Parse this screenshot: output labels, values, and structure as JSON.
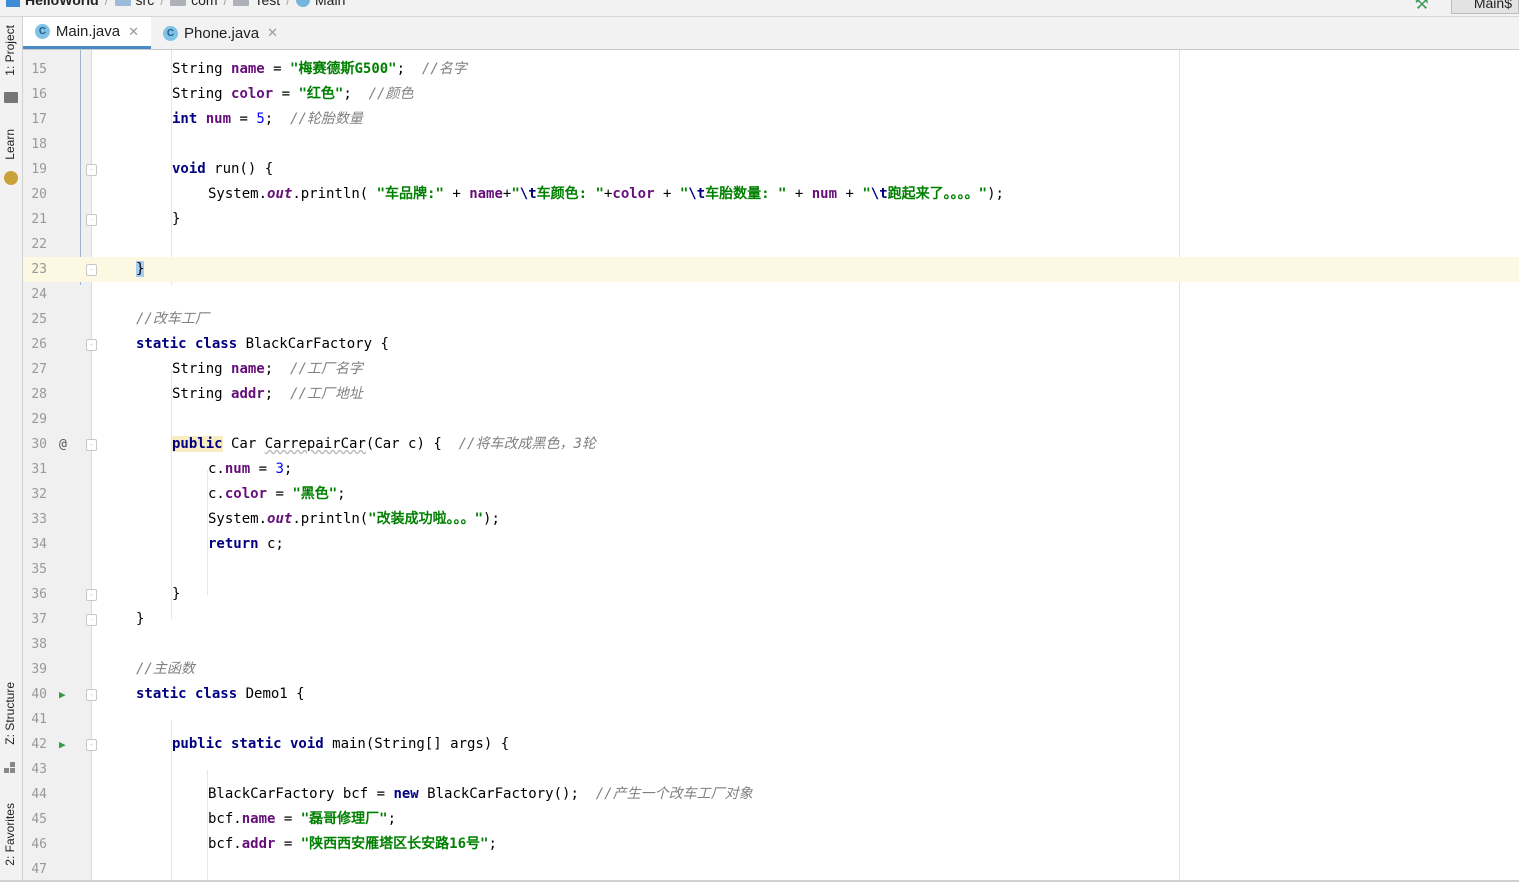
{
  "navbar": {
    "breadcrumbs": [
      {
        "label": "HelloWorld",
        "icon": "project-icon"
      },
      {
        "label": "src",
        "icon": "folder-icon"
      },
      {
        "label": "com",
        "icon": "package-icon"
      },
      {
        "label": "Test",
        "icon": "package-icon"
      },
      {
        "label": "Main",
        "icon": "class-icon"
      }
    ],
    "run_config": "Main$"
  },
  "sidebar": {
    "top": [
      {
        "label": "1: Project"
      },
      {
        "label": "Learn"
      }
    ],
    "bottom": [
      {
        "label": "Z: Structure"
      },
      {
        "label": "2: Favorites"
      }
    ]
  },
  "tabs": [
    {
      "label": "Main.java",
      "icon": "C",
      "active": true
    },
    {
      "label": "Phone.java",
      "icon": "C",
      "active": false
    }
  ],
  "editor": {
    "current_line": 23,
    "lines": [
      {
        "n": "15"
      },
      {
        "n": "16"
      },
      {
        "n": "17"
      },
      {
        "n": "18"
      },
      {
        "n": "19"
      },
      {
        "n": "20"
      },
      {
        "n": "21"
      },
      {
        "n": "22"
      },
      {
        "n": "23"
      },
      {
        "n": "24"
      },
      {
        "n": "25"
      },
      {
        "n": "26"
      },
      {
        "n": "27"
      },
      {
        "n": "28"
      },
      {
        "n": "29"
      },
      {
        "n": "30"
      },
      {
        "n": "31"
      },
      {
        "n": "32"
      },
      {
        "n": "33"
      },
      {
        "n": "34"
      },
      {
        "n": "35"
      },
      {
        "n": "36"
      },
      {
        "n": "37"
      },
      {
        "n": "38"
      },
      {
        "n": "39"
      },
      {
        "n": "40"
      },
      {
        "n": "41"
      },
      {
        "n": "42"
      },
      {
        "n": "43"
      },
      {
        "n": "44"
      },
      {
        "n": "45"
      },
      {
        "n": "46"
      },
      {
        "n": "47"
      }
    ],
    "code": {
      "l15": {
        "t1": "String ",
        "f": "name",
        "t2": " = ",
        "s": "\"梅赛德斯G500\"",
        "t3": ";  ",
        "c": "//名字"
      },
      "l16": {
        "t1": "String ",
        "f": "color",
        "t2": " = ",
        "s": "\"红色\"",
        "t3": ";  ",
        "c": "//颜色"
      },
      "l17": {
        "k": "int",
        "t1": " ",
        "f": "num",
        "t2": " = ",
        "v": "5",
        "t3": ";  ",
        "c": "//轮胎数量"
      },
      "l19": {
        "k": "void",
        "t1": " run() {"
      },
      "l20": {
        "t1": "System.",
        "st": "out",
        "t2": ".println( ",
        "s1": "\"车品牌:\"",
        "t3": " + ",
        "f1": "name",
        "t4": "+",
        "s2a": "\"",
        "e1": "\\t",
        "s2b": "车颜色: \"",
        "t5": "+",
        "f2": "color",
        "t6": " + ",
        "s3a": "\"",
        "e2": "\\t",
        "s3b": "车胎数量: \"",
        "t7": " + ",
        "f3": "num",
        "t8": " + ",
        "s4a": "\"",
        "e3": "\\t",
        "s4b": "跑起来了。。。。\"",
        "t9": ");"
      },
      "l21": {
        "t1": "}"
      },
      "l23": {
        "t1": "}"
      },
      "l25": {
        "c": "//改车工厂"
      },
      "l26": {
        "k": "static class",
        "t1": " BlackCarFactory {"
      },
      "l27": {
        "t1": "String ",
        "f": "name",
        "t2": ";  ",
        "c": "//工厂名字"
      },
      "l28": {
        "t1": "String ",
        "f": "addr",
        "t2": ";  ",
        "c": "//工厂地址"
      },
      "l30": {
        "k": "public",
        "t1": " Car ",
        "m": "CarrepairCar",
        "t2": "(Car c) {  ",
        "c": "//将车改成黑色，3轮"
      },
      "l31": {
        "t1": "c.",
        "f": "num",
        "t2": " = ",
        "v": "3",
        "t3": ";"
      },
      "l32": {
        "t1": "c.",
        "f": "color",
        "t2": " = ",
        "s": "\"黑色\"",
        "t3": ";"
      },
      "l33": {
        "t1": "System.",
        "st": "out",
        "t2": ".println(",
        "s": "\"改装成功啦。。。\"",
        "t3": ");"
      },
      "l34": {
        "k": "return",
        "t1": " c;"
      },
      "l36": {
        "t1": "}"
      },
      "l37": {
        "t1": "}"
      },
      "l39": {
        "c": "//主函数"
      },
      "l40": {
        "k": "static class",
        "t1": " Demo1 {"
      },
      "l42": {
        "k": "public static void",
        "t1": " main(String[] args) {"
      },
      "l44": {
        "t1": "BlackCarFactory bcf = ",
        "k": "new",
        "t2": " BlackCarFactory();  ",
        "c": "//产生一个改车工厂对象"
      },
      "l45": {
        "t1": "bcf.",
        "f": "name",
        "t2": " = ",
        "s": "\"磊哥修理厂\"",
        "t3": ";"
      },
      "l46": {
        "t1": "bcf.",
        "f": "addr",
        "t2": " = ",
        "s": "\"陕西西安雁塔区长安路16号\"",
        "t3": ";"
      }
    }
  }
}
